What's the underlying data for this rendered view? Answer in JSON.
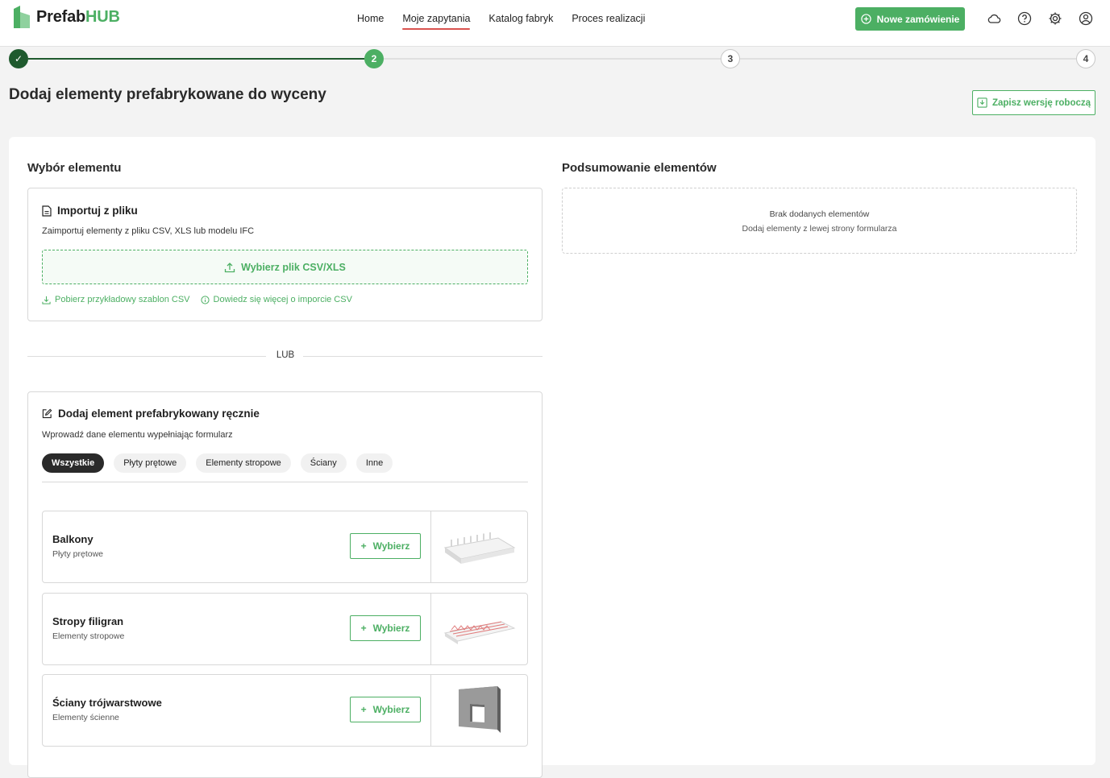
{
  "app": {
    "logo_main": "Prefab",
    "logo_accent": "HUB"
  },
  "nav": {
    "items": [
      {
        "label": "Home"
      },
      {
        "label": "Moje zapytania",
        "active": true
      },
      {
        "label": "Katalog fabryk"
      },
      {
        "label": "Proces realizacji"
      }
    ],
    "new_order_label": "Nowe zamówienie",
    "icons": [
      "cloud-icon",
      "help-icon",
      "gear-icon",
      "user-icon"
    ]
  },
  "stepper": {
    "steps": [
      {
        "label": "✓",
        "state": "done"
      },
      {
        "label": "2",
        "state": "current"
      },
      {
        "label": "3",
        "state": "todo"
      },
      {
        "label": "4",
        "state": "todo"
      }
    ]
  },
  "page": {
    "title": "Dodaj elementy prefabrykowane do wyceny",
    "draft_label": "Zapisz wersję roboczą"
  },
  "selection": {
    "title": "Wybór elementu",
    "import": {
      "title": "Importuj z pliku",
      "subtitle": "Zaimportuj elementy z pliku CSV, XLS lub modelu IFC",
      "upload_label": "Wybierz plik CSV/XLS",
      "template_link": "Pobierz przykładowy szablon CSV",
      "learn_link": "Dowiedz się więcej o imporcie CSV"
    },
    "or_label": "LUB",
    "manual": {
      "title": "Dodaj element prefabrykowany ręcznie",
      "subtitle": "Wprowadź dane elementu wypełniając formularz",
      "filters": [
        {
          "label": "Wszystkie",
          "active": true
        },
        {
          "label": "Płyty prętowe"
        },
        {
          "label": "Elementy stropowe"
        },
        {
          "label": "Ściany"
        },
        {
          "label": "Inne"
        }
      ],
      "select_label": "Wybierz",
      "elements": [
        {
          "name": "Balkony",
          "category": "Płyty prętowe",
          "image": "balcony-slab-image"
        },
        {
          "name": "Stropy filigran",
          "category": "Elementy stropowe",
          "image": "filigran-slab-image"
        },
        {
          "name": "Ściany trójwarstwowe",
          "category": "Elementy ścienne",
          "image": "sandwich-wall-image"
        }
      ]
    }
  },
  "summary": {
    "title": "Podsumowanie elementów",
    "empty_title": "Brak dodanych elementów",
    "empty_hint": "Dodaj elementy z lewej strony formularza"
  },
  "colors": {
    "accent": "#4caf63",
    "done": "#1f5a2e",
    "nav_active_underline": "#d9534f"
  }
}
